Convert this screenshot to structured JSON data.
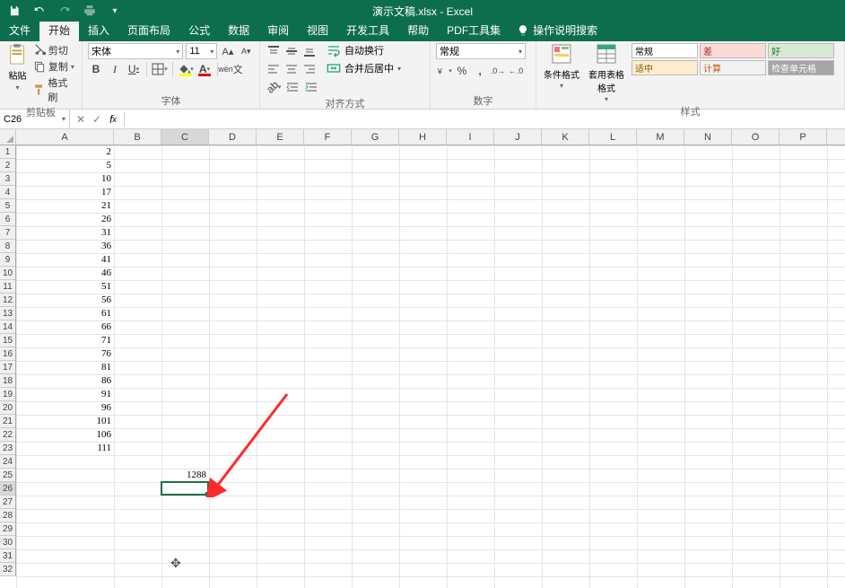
{
  "title": "演示文稿.xlsx - Excel",
  "tabs": {
    "file": "文件",
    "home": "开始",
    "insert": "插入",
    "layout": "页面布局",
    "formulas": "公式",
    "data": "数据",
    "review": "审阅",
    "view": "视图",
    "dev": "开发工具",
    "help": "帮助",
    "pdf": "PDF工具集",
    "tellme": "操作说明搜索"
  },
  "ribbon": {
    "clipboard": {
      "label": "剪贴板",
      "paste": "粘贴",
      "cut": "剪切",
      "copy": "复制",
      "painter": "格式刷"
    },
    "font": {
      "label": "字体",
      "name": "宋体",
      "size": "11"
    },
    "alignment": {
      "label": "对齐方式",
      "wrap": "自动换行",
      "merge": "合并后居中"
    },
    "number": {
      "label": "数字",
      "format": "常规"
    },
    "styles": {
      "label": "样式",
      "cond": "条件格式",
      "table": "套用表格格式",
      "g1": "常规",
      "g2": "差",
      "g3": "好",
      "g4": "适中",
      "g5": "计算",
      "g6": "检查单元格"
    }
  },
  "formula_bar": {
    "name_box": "C26",
    "fx_value": ""
  },
  "columns": [
    "A",
    "B",
    "C",
    "D",
    "E",
    "F",
    "G",
    "H",
    "I",
    "J",
    "K",
    "L",
    "M",
    "N",
    "O",
    "P"
  ],
  "rows": 32,
  "colA": [
    2,
    5,
    10,
    17,
    21,
    26,
    31,
    36,
    41,
    46,
    51,
    56,
    61,
    66,
    71,
    76,
    81,
    86,
    91,
    96,
    101,
    106,
    111
  ],
  "c25": 1288,
  "active_cell": "C26",
  "chart_data": {
    "type": "table",
    "title": "",
    "sheets": [
      "A1:A23 data values",
      "C25 sum"
    ],
    "A": [
      2,
      5,
      10,
      17,
      21,
      26,
      31,
      36,
      41,
      46,
      51,
      56,
      61,
      66,
      71,
      76,
      81,
      86,
      91,
      96,
      101,
      106,
      111
    ],
    "C25": 1288
  }
}
